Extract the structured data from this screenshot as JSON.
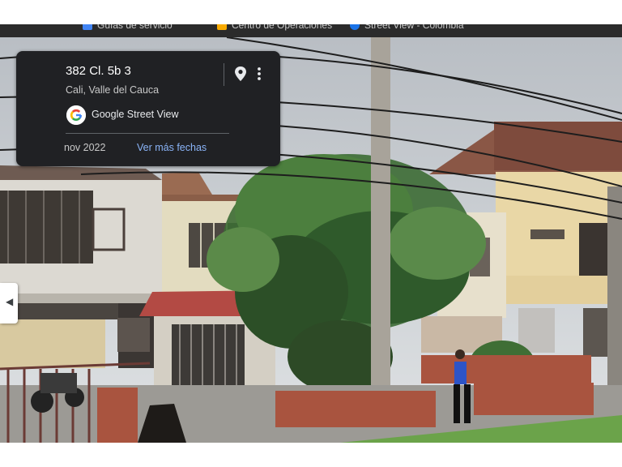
{
  "bookmarks": [
    {
      "label": "Guías de servicio",
      "icon": "bookmark-icon",
      "color": "#4285f4"
    },
    {
      "label": "Centro de Operaciones",
      "icon": "folder-icon",
      "color": "#f9ab00"
    },
    {
      "label": "Street View - Colombia",
      "icon": "street-view-icon",
      "color": "#1a73e8"
    }
  ],
  "info_card": {
    "address": "382 Cl. 5b 3",
    "locality": "Cali, Valle del Cauca",
    "source": "Google Street View",
    "capture_date": "nov 2022",
    "more_dates_link": "Ver más fechas",
    "pin_icon": "location-pin-icon",
    "menu_icon": "more-vert-icon",
    "logo_icon": "google-g-logo-icon"
  },
  "side_toggle_icon": "chevron-left-icon",
  "colors": {
    "card_bg": "#202124",
    "link_blue": "#8ab4f8",
    "bookmark_bar": "#2b2b2b"
  }
}
